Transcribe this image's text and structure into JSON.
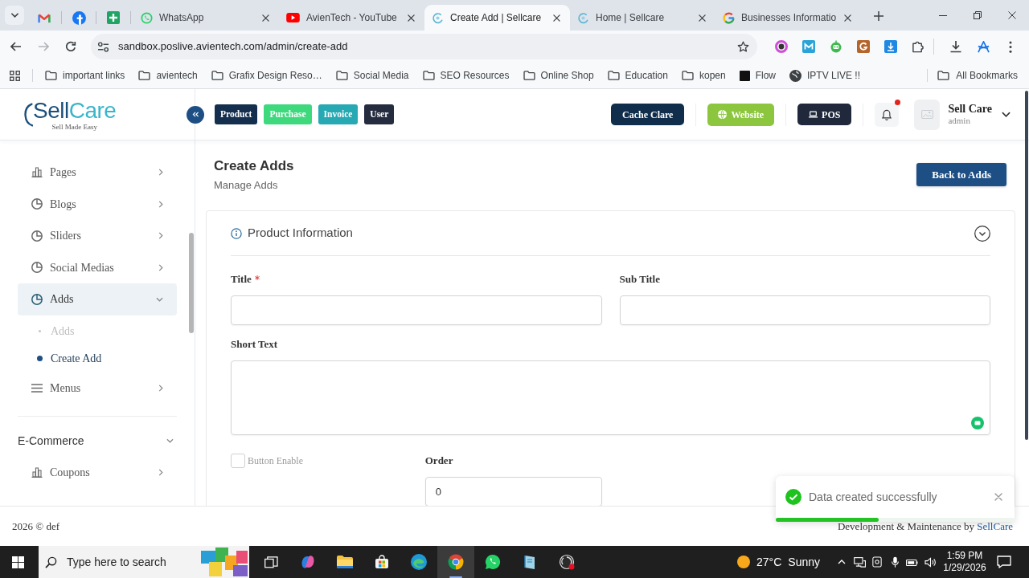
{
  "browser": {
    "tabs": [
      {
        "title": "WhatsApp",
        "selected": false
      },
      {
        "title": "AvienTech - YouTube",
        "selected": false
      },
      {
        "title": "Create Add | Sellcare",
        "selected": true
      },
      {
        "title": "Home | Sellcare",
        "selected": false
      },
      {
        "title": "Businesses Informatio",
        "selected": false
      }
    ],
    "url": "sandbox.poslive.avientech.com/admin/create-add",
    "bookmarks": [
      {
        "label": "important links",
        "kind": "folder"
      },
      {
        "label": "avientech",
        "kind": "folder"
      },
      {
        "label": "Grafix Design Reso…",
        "kind": "folder"
      },
      {
        "label": "Social Media",
        "kind": "folder"
      },
      {
        "label": "SEO Resources",
        "kind": "folder"
      },
      {
        "label": "Online Shop",
        "kind": "folder"
      },
      {
        "label": "Education",
        "kind": "folder"
      },
      {
        "label": "kopen",
        "kind": "folder"
      },
      {
        "label": "Flow",
        "kind": "site"
      },
      {
        "label": "IPTV LIVE !!",
        "kind": "site"
      }
    ],
    "all_bookmarks": "All Bookmarks"
  },
  "header": {
    "logo": {
      "parts": [
        "Sell",
        "Care"
      ],
      "tagline": "Sell Made Easy"
    },
    "nav_buttons": [
      {
        "label": "Product",
        "color": "#142f4d"
      },
      {
        "label": "Purchase",
        "color": "#3ed97c"
      },
      {
        "label": "Invoice",
        "color": "#26a9b3"
      },
      {
        "label": "User",
        "color": "#252c3f"
      }
    ],
    "actions": [
      {
        "label": "Cache Clare",
        "color": "#102e4c"
      },
      {
        "label": "Website",
        "color": "#8cc63e"
      },
      {
        "label": "POS",
        "color": "#1f293b"
      }
    ],
    "notifications": {
      "unread": true
    },
    "user": {
      "name": "Sell Care",
      "role": "admin"
    }
  },
  "sidebar": {
    "sections": [
      {
        "items": [
          {
            "label": "Pages",
            "expanded": false,
            "selected": false
          },
          {
            "label": "Blogs",
            "expanded": false,
            "selected": false
          },
          {
            "label": "Sliders",
            "expanded": false,
            "selected": false
          },
          {
            "label": "Social Medias",
            "expanded": false,
            "selected": false
          },
          {
            "label": "Adds",
            "expanded": true,
            "selected": true,
            "children": [
              {
                "label": "Adds",
                "selected": false
              },
              {
                "label": "Create Add",
                "selected": true
              }
            ]
          },
          {
            "label": "Menus",
            "expanded": false,
            "selected": false
          }
        ]
      },
      {
        "title": "E-Commerce",
        "expanded": true,
        "items": [
          {
            "label": "Coupons",
            "expanded": false,
            "selected": false
          }
        ]
      }
    ]
  },
  "page": {
    "title": "Create Adds",
    "subtitle": "Manage Adds",
    "back_button": "Back to Adds",
    "card": {
      "title": "Product Information",
      "expanded": true,
      "rows": [
        [
          {
            "kind": "input",
            "label": "Title",
            "required": true
          },
          {
            "kind": "input",
            "label": "Sub Title",
            "required": false
          }
        ],
        [
          {
            "kind": "textarea",
            "label": "Short Text",
            "required": false
          }
        ],
        [
          {
            "kind": "checkbox",
            "label": "Button Enable",
            "checked": false,
            "disabled": true
          },
          {
            "kind": "input",
            "label": "Order",
            "required": false,
            "value": "0"
          }
        ]
      ]
    }
  },
  "toast": {
    "kind": "success",
    "message": "Data created successfully",
    "level": 0.43
  },
  "footer": {
    "copyright": "2026 © def",
    "credit": "Development & Maintenance by",
    "credit_link": "SellCare"
  },
  "taskbar": {
    "search": {
      "placeholder": "Type here to search"
    },
    "apps": [
      {
        "open": false,
        "selected": false
      },
      {
        "open": false,
        "selected": false
      },
      {
        "open": false,
        "selected": false
      },
      {
        "open": false,
        "selected": false
      },
      {
        "open": false,
        "selected": false
      },
      {
        "open": true,
        "selected": true
      },
      {
        "open": false,
        "selected": false
      },
      {
        "open": false,
        "selected": false
      },
      {
        "open": false,
        "selected": false
      }
    ],
    "weather": {
      "temperature": "27°C",
      "condition": "Sunny"
    },
    "clock": {
      "time": "1:59 PM",
      "date": "1/29/2026"
    }
  }
}
